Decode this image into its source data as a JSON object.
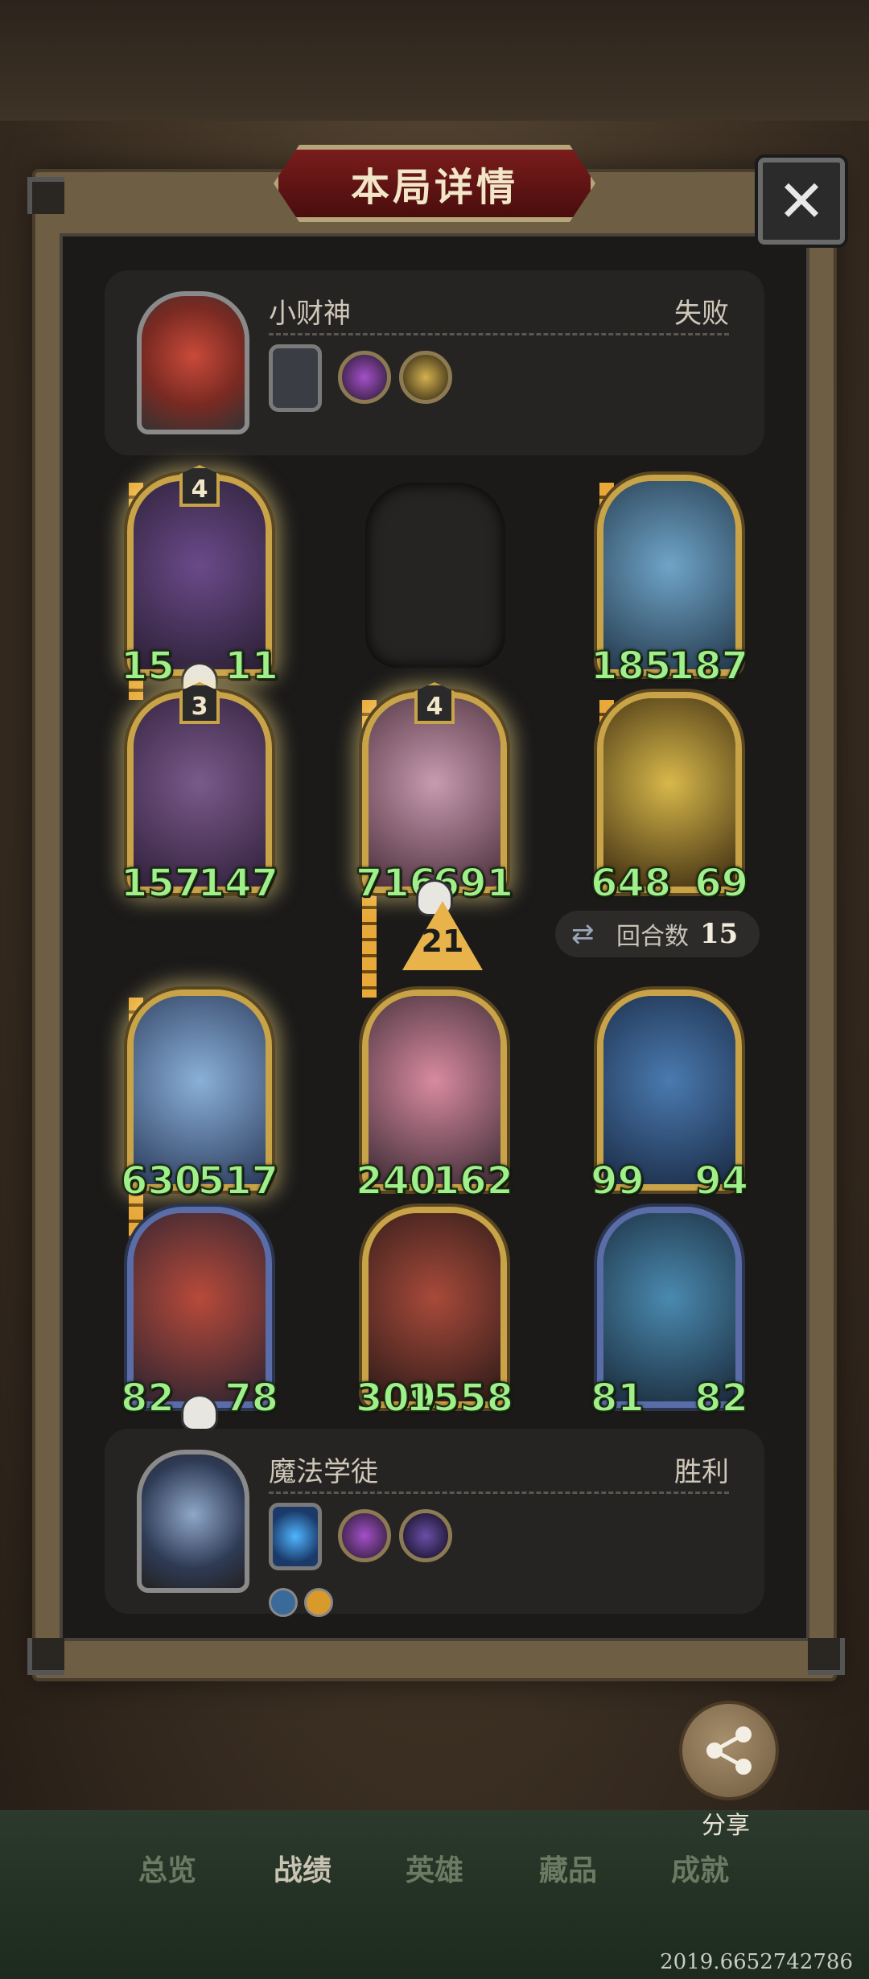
{
  "title": "本局详情",
  "close_label": "✕",
  "player_top": {
    "name": "小财神",
    "result": "失败"
  },
  "player_bottom": {
    "name": "魔法学徒",
    "result": "胜利"
  },
  "units": [
    {
      "tier": "4",
      "atk": "15",
      "hp": "11"
    },
    {
      "atk": "185",
      "hp": "187"
    },
    {
      "tier": "3",
      "atk": "157",
      "hp": "147"
    },
    {
      "tier": "4",
      "atk": "716",
      "hp": "691"
    },
    {
      "atk": "648",
      "hp": "69"
    },
    {
      "atk": "630",
      "hp": "517"
    },
    {
      "atk": "240",
      "hp": "162"
    },
    {
      "atk": "99",
      "hp": "94"
    },
    {
      "atk": "82",
      "hp": "78"
    },
    {
      "atk": "309",
      "hp": "1558"
    },
    {
      "atk": "81",
      "hp": "82"
    }
  ],
  "arrow_value": "21",
  "rounds": {
    "label": "回合数",
    "value": "15"
  },
  "share_label": "分享",
  "nav": [
    "总览",
    "战绩",
    "英雄",
    "藏品",
    "成就"
  ],
  "footer_number": "2019.6652742786",
  "icons": [
    "close-icon",
    "share-icon",
    "rounds-swap-icon",
    "skull-icon",
    "tombstone-icon"
  ],
  "colors": {
    "stat_green": "#9ff08a",
    "gold_border": "#c8a347",
    "banner_red": "#7a1c1c"
  }
}
